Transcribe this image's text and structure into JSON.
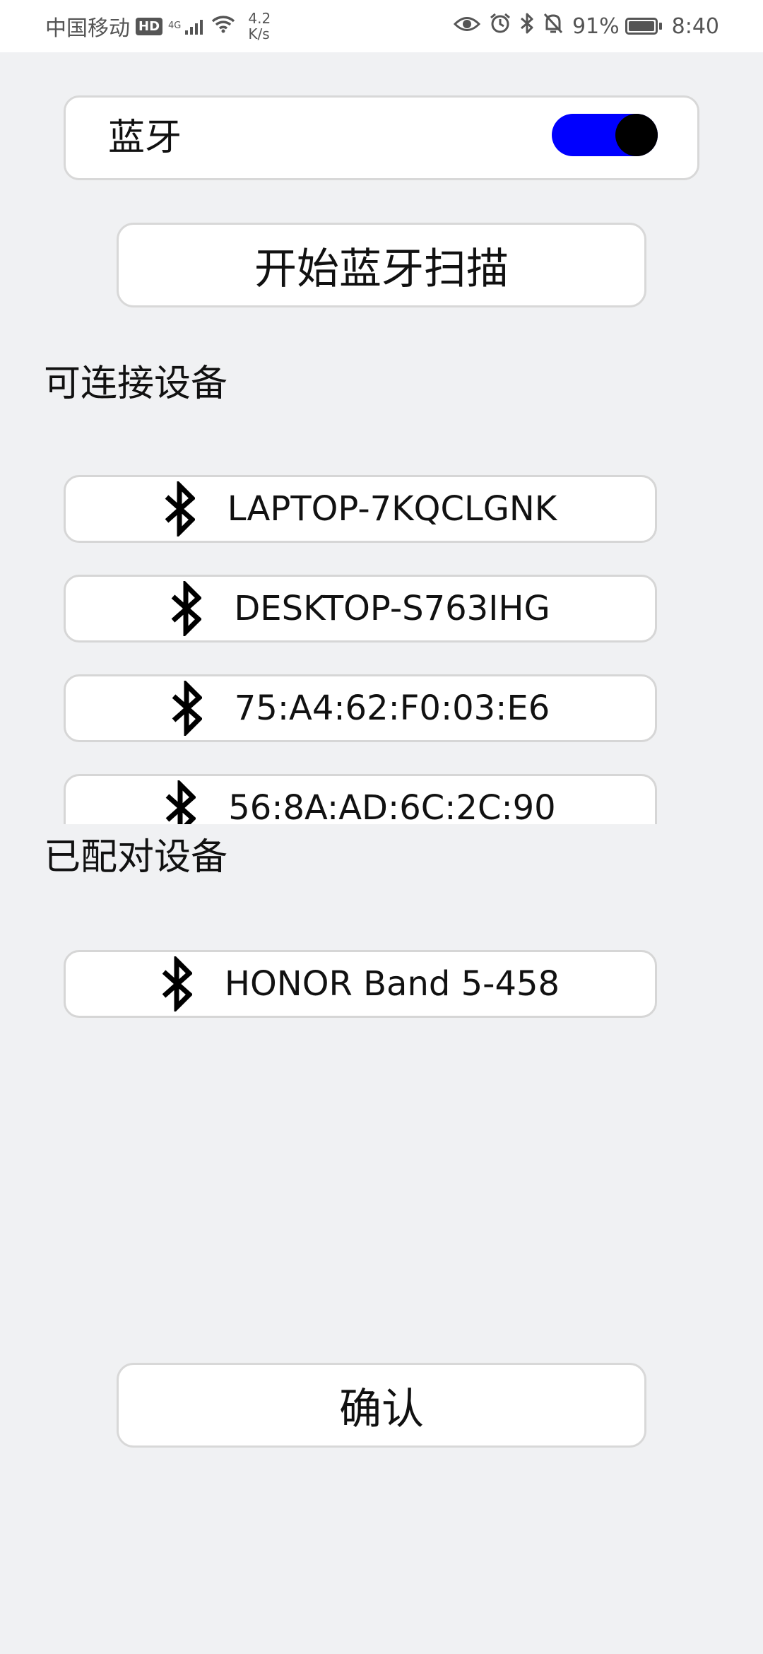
{
  "status_bar": {
    "carrier": "中国移动",
    "hd": "HD",
    "network_type": "4G",
    "speed_value": "4.2",
    "speed_unit": "K/s",
    "battery": "91%",
    "time": "8:40",
    "icons": [
      "eye-icon",
      "alarm-icon",
      "bluetooth-icon",
      "bell-off-icon"
    ]
  },
  "bluetooth": {
    "label": "蓝牙",
    "enabled": true,
    "toggle_color": "#0000ff"
  },
  "scan_button": "开始蓝牙扫描",
  "available_title": "可连接设备",
  "available_devices": [
    {
      "name": "LAPTOP-7KQCLGNK",
      "icon": "bluetooth-icon"
    },
    {
      "name": "DESKTOP-S763IHG",
      "icon": "bluetooth-icon"
    },
    {
      "name": "75:A4:62:F0:03:E6",
      "icon": "bluetooth-icon"
    },
    {
      "name": "56:8A:AD:6C:2C:90",
      "icon": "bluetooth-icon"
    }
  ],
  "paired_title": "已配对设备",
  "paired_devices": [
    {
      "name": "HONOR Band 5-458",
      "icon": "bluetooth-icon"
    }
  ],
  "confirm_button": "确认"
}
